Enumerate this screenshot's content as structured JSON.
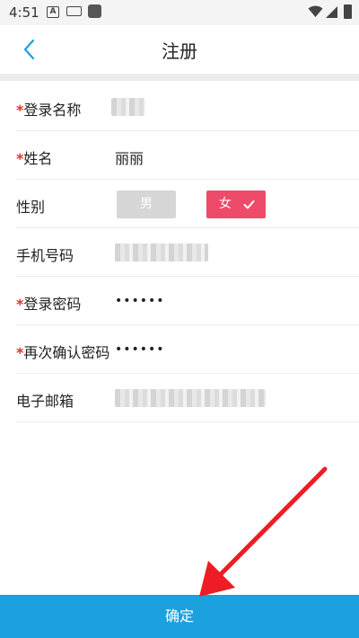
{
  "status_bar": {
    "time": "4:51",
    "badge_letter": "A"
  },
  "header": {
    "title": "注册"
  },
  "form": {
    "required_mark": "*",
    "login_name": {
      "label": "登录名称",
      "required": true
    },
    "name": {
      "label": "姓名",
      "value": "丽丽",
      "required": true
    },
    "gender": {
      "label": "性别",
      "options": [
        "男",
        "女"
      ],
      "selected": "女"
    },
    "phone": {
      "label": "手机号码"
    },
    "password": {
      "label": "登录密码",
      "value": "••••••",
      "required": true
    },
    "confirm_password": {
      "label": "再次确认密码",
      "value": "••••••",
      "required": true
    },
    "email": {
      "label": "电子邮箱"
    }
  },
  "confirm_button": {
    "label": "确定"
  },
  "colors": {
    "accent": "#1ba1de",
    "selected_gender": "#ee4a6a",
    "unselected_gender": "#d6d6d6",
    "required": "#e3322c",
    "annotation_arrow": "#ee1c24"
  }
}
